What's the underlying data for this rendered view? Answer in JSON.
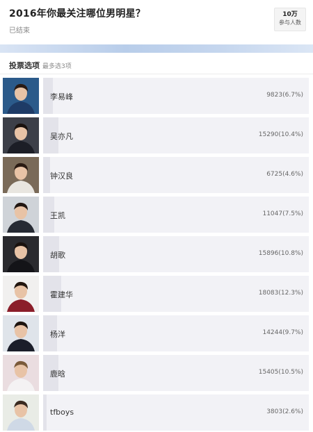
{
  "poll": {
    "title": "2016年你最关注哪位男明星？",
    "status": "已结束",
    "participants_value": "10万",
    "participants_label": "参与人数"
  },
  "options_header": {
    "title": "投票选项",
    "subtitle": "最多选3项"
  },
  "candidates": [
    {
      "name": "李易峰",
      "result": "9823(6.7%)",
      "percent": 6.7
    },
    {
      "name": "吴亦凡",
      "result": "15290(10.4%)",
      "percent": 10.4
    },
    {
      "name": "钟汉良",
      "result": "6725(4.6%)",
      "percent": 4.6
    },
    {
      "name": "王凯",
      "result": "11047(7.5%)",
      "percent": 7.5
    },
    {
      "name": "胡歌",
      "result": "15896(10.8%)",
      "percent": 10.8
    },
    {
      "name": "霍建华",
      "result": "18083(12.3%)",
      "percent": 12.3
    },
    {
      "name": "杨洋",
      "result": "14244(9.7%)",
      "percent": 9.7
    },
    {
      "name": "鹿晗",
      "result": "15405(10.5%)",
      "percent": 10.5
    },
    {
      "name": "tfboys",
      "result": "3803(2.6%)",
      "percent": 2.6
    }
  ],
  "colors": {
    "bar_track": "#f2f2f6",
    "bar_fill": "#e3e3ea"
  }
}
